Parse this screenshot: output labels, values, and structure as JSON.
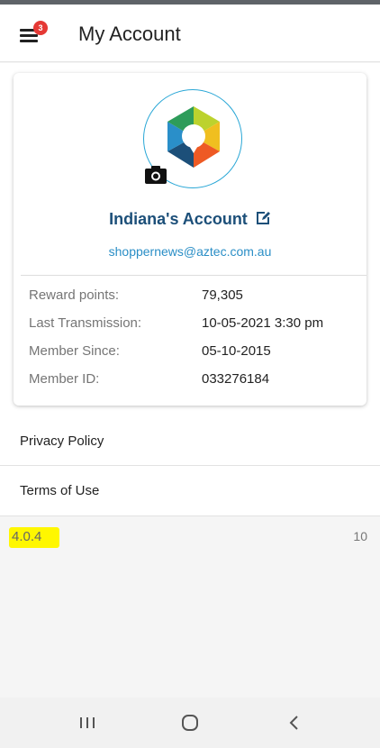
{
  "header": {
    "title": "My Account",
    "menu_badge": "3",
    "menu_icon": "hamburger-icon"
  },
  "profile": {
    "account_name": "Indiana's Account",
    "email": "shoppernews@aztec.com.au",
    "avatar_icon": "hexagon-logo",
    "camera_icon": "camera-icon",
    "edit_icon": "edit-icon"
  },
  "details": [
    {
      "label": "Reward points:",
      "value": "79,305"
    },
    {
      "label": "Last Transmission:",
      "value": "10-05-2021 3:30 pm"
    },
    {
      "label": "Member Since:",
      "value": "05-10-2015"
    },
    {
      "label": "Member ID:",
      "value": "033276184"
    }
  ],
  "links": {
    "privacy": "Privacy Policy",
    "terms": "Terms of Use"
  },
  "footer": {
    "version": "4.0.4",
    "build": "10"
  },
  "colors": {
    "accent": "#2aa7d6",
    "account_name": "#1c4f79",
    "badge": "#e53935",
    "highlight": "#fff700"
  }
}
